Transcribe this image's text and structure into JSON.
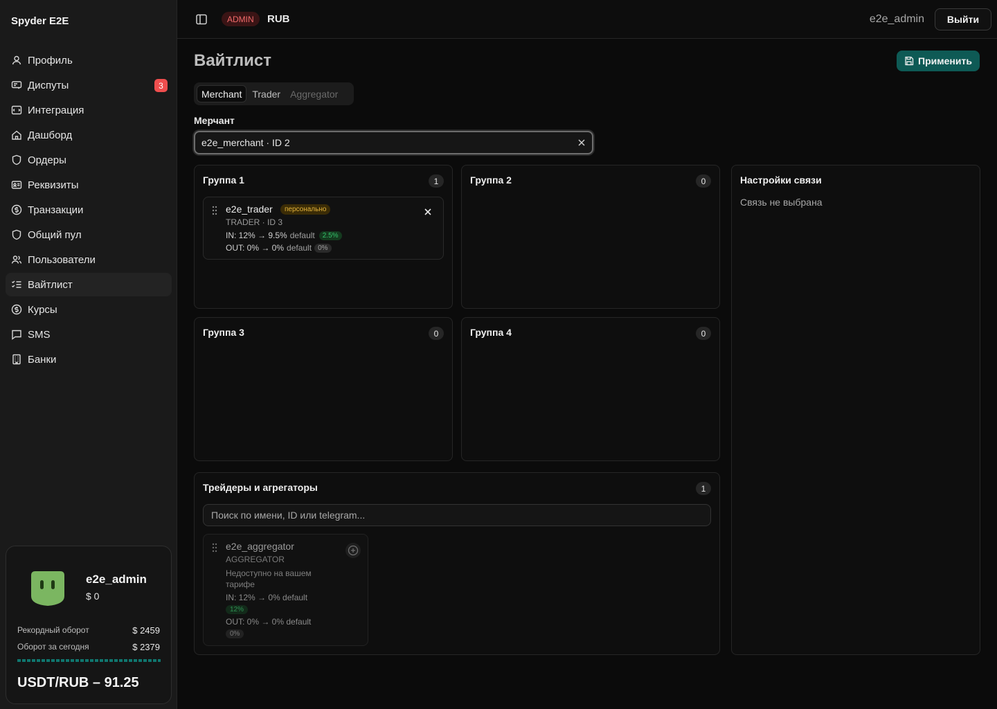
{
  "app": {
    "brand": "Spyder E2E"
  },
  "sidebar": {
    "items": [
      {
        "label": "Профиль",
        "icon": "user-icon"
      },
      {
        "label": "Диспуты",
        "icon": "disputes-icon",
        "badge": "3"
      },
      {
        "label": "Интеграция",
        "icon": "integration-icon"
      },
      {
        "label": "Дашборд",
        "icon": "home-icon"
      },
      {
        "label": "Ордеры",
        "icon": "shield-icon"
      },
      {
        "label": "Реквизиты",
        "icon": "id-card-icon"
      },
      {
        "label": "Транзакции",
        "icon": "dollar-circle-icon"
      },
      {
        "label": "Общий пул",
        "icon": "shield-icon"
      },
      {
        "label": "Пользователи",
        "icon": "users-icon"
      },
      {
        "label": "Вайтлист",
        "icon": "list-check-icon",
        "active": true
      },
      {
        "label": "Курсы",
        "icon": "dollar-circle-icon"
      },
      {
        "label": "SMS",
        "icon": "message-icon"
      },
      {
        "label": "Банки",
        "icon": "building-icon"
      }
    ]
  },
  "user_card": {
    "name": "e2e_admin",
    "balance": "$ 0",
    "record_label": "Рекордный оборот",
    "record_value": "$ 2459",
    "today_label": "Оборот за сегодня",
    "today_value": "$ 2379",
    "rate": "USDT/RUB – 91.25",
    "avatar_color": "#7bb661"
  },
  "header": {
    "role_badge": "ADMIN",
    "currency": "RUB",
    "username": "e2e_admin",
    "logout_label": "Выйти"
  },
  "page": {
    "title": "Вайтлист",
    "apply_label": "Применить",
    "tabs": [
      {
        "label": "Merchant",
        "state": "active"
      },
      {
        "label": "Trader",
        "state": "normal"
      },
      {
        "label": "Aggregator",
        "state": "disabled"
      }
    ],
    "merchant_label": "Мерчант",
    "merchant_value": "e2e_merchant · ID 2"
  },
  "groups": [
    {
      "title": "Группа 1",
      "count": "1",
      "members": [
        {
          "name": "e2e_trader",
          "badge": "персонально",
          "sub": "TRADER · ID 3",
          "in_line": "IN: 12% → 9.5%",
          "in_default": "default",
          "in_pill": "2.5%",
          "out_line": "OUT: 0% → 0%",
          "out_default": "default",
          "out_pill": "0%"
        }
      ]
    },
    {
      "title": "Группа 2",
      "count": "0",
      "members": []
    },
    {
      "title": "Группа 3",
      "count": "0",
      "members": []
    },
    {
      "title": "Группа 4",
      "count": "0",
      "members": []
    }
  ],
  "connection": {
    "title": "Настройки связи",
    "empty_text": "Связь не выбрана"
  },
  "pool": {
    "title": "Трейдеры и агрегаторы",
    "count": "1",
    "search_placeholder": "Поиск по имени, ID или telegram...",
    "items": [
      {
        "name": "e2e_aggregator",
        "sub": "AGGREGATOR",
        "note": "Недоступно на вашем тарифе",
        "in_line": "IN: 12% → 0% default",
        "in_pill": "12%",
        "out_line": "OUT: 0% → 0% default",
        "out_pill": "0%"
      }
    ]
  },
  "colors": {
    "accent": "#0e5a55",
    "danger": "#ef4e4e",
    "positive": "#35c06b",
    "warning": "#e3b33b"
  }
}
